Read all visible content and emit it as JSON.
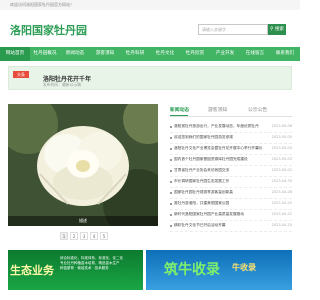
{
  "topbar": {
    "welcome": "欢迎访问洛阳国家牡丹园官方网站！"
  },
  "header": {
    "logo": "洛阳国家牡丹园",
    "search_placeholder": "请输入关键字",
    "search_button": "搜索"
  },
  "nav": [
    {
      "label": "网站首页",
      "active": true
    },
    {
      "label": "牡丹园概况"
    },
    {
      "label": "新闻动态"
    },
    {
      "label": "游客须知"
    },
    {
      "label": "牡丹科研"
    },
    {
      "label": "牡丹文化"
    },
    {
      "label": "牡丹欣赏"
    },
    {
      "label": "产业开发"
    },
    {
      "label": "在线留言"
    },
    {
      "label": "联系我们"
    }
  ],
  "banner": {
    "tag": "头条",
    "title": "洛阳牡丹花开千年",
    "subtitle": "发布时间：最新公示稿"
  },
  "photo": {
    "caption": "描述"
  },
  "tabs": [
    "新闻动态",
    "游客须知",
    "公示公告"
  ],
  "news": [
    {
      "title": "洛阳赏牡丹旅游出行，产业发展动态，年度优质牡丹",
      "date": "2023-05-06"
    },
    {
      "title": "欢迎您到我们的国家牡丹园游览参观",
      "date": "2023-05-05"
    },
    {
      "title": "洛阳牡丹文化产业博览会暨牡丹花卉展中心举行开幕仪式",
      "date": "2023-05-04"
    },
    {
      "title": "国内首个牡丹国家基因资源库牡丹园完成建设",
      "date": "2023-05-03"
    },
    {
      "title": "甘肃省牡丹产业协会来访我园交流",
      "date": "2023-05-02"
    },
    {
      "title": "市长调研国家牡丹园生态发展工作",
      "date": "2023-04-30"
    },
    {
      "title": "国家牡丹园牡丹观赏季游客量创新高",
      "date": "2023-04-28"
    },
    {
      "title": "赏牡丹游洛阳，共建美丽国家公园",
      "date": "2023-04-25"
    },
    {
      "title": "新时代洛阳国家牡丹园产业高质量发展推动",
      "date": "2023-04-22"
    },
    {
      "title": "精彩牡丹文化节已开启活动开幕",
      "date": "2023-04-20"
    }
  ],
  "pager": [
    "1",
    "2",
    "3",
    "4",
    "5"
  ],
  "ads": {
    "left_big": "生态业务",
    "left_lines": [
      "综合标准化，标准体系，标准化，化二化",
      "专业牡丹种植苗木培育，精品苗木生产",
      "种苗繁育 · 栽培技术 · 技术服务"
    ],
    "right_big": "筑牛收录",
    "right_small": "牛收录"
  }
}
